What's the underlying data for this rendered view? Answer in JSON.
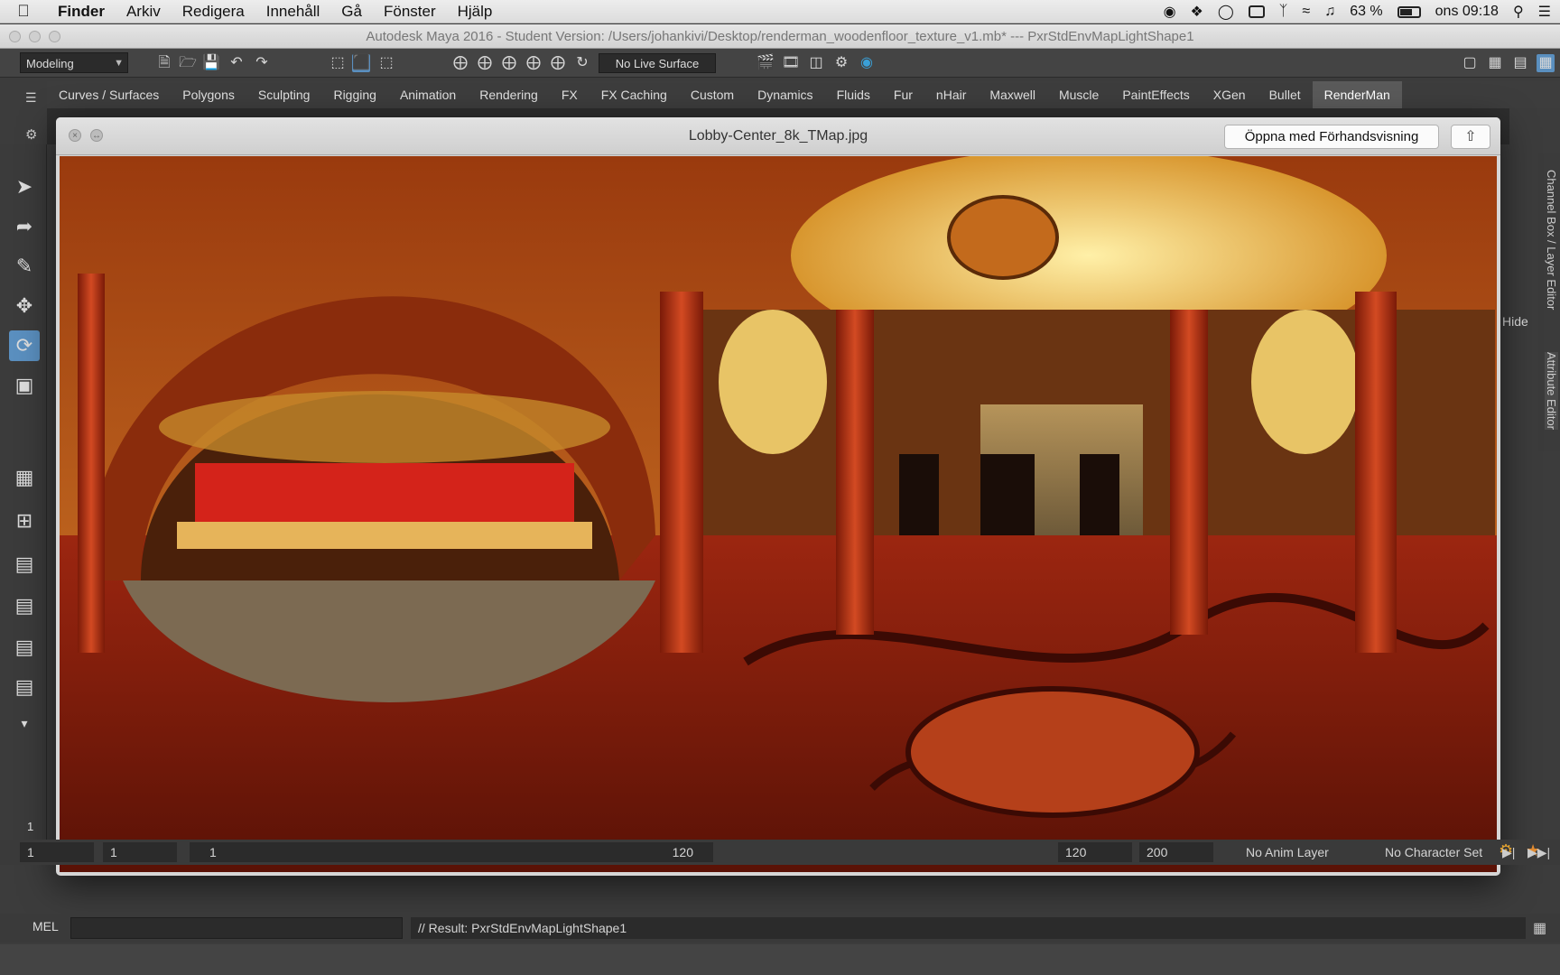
{
  "menubar": {
    "app": "Finder",
    "items": [
      "Arkiv",
      "Redigera",
      "Innehåll",
      "Gå",
      "Fönster",
      "Hjälp"
    ],
    "battery": "63 %",
    "clock": "ons 09:18"
  },
  "maya": {
    "window_title": "Autodesk Maya 2016 - Student Version: /Users/johankivi/Desktop/renderman_woodenfloor_texture_v1.mb*   ---   PxrStdEnvMapLightShape1",
    "mode": "Modeling",
    "live_surface": "No Live Surface",
    "shelf_tabs": [
      "Curves / Surfaces",
      "Polygons",
      "Sculpting",
      "Rigging",
      "Animation",
      "Rendering",
      "FX",
      "FX Caching",
      "Custom",
      "Dynamics",
      "Fluids",
      "Fur",
      "nHair",
      "Maxwell",
      "Muscle",
      "PaintEffects",
      "XGen",
      "Bullet",
      "RenderMan"
    ],
    "active_shelf": "RenderMan",
    "right_tabs": {
      "channel_box": "Channel Box / Layer Editor",
      "attribute_editor": "Attribute Editor"
    },
    "right_panel_label": "Hide",
    "timeline": {
      "current": "1",
      "start": "1",
      "range_start": "1",
      "range_end": "120",
      "end": "120",
      "max": "200",
      "anim_layer": "No Anim Layer",
      "char_set": "No Character Set",
      "frame_marker": "1"
    },
    "command": {
      "label": "MEL",
      "result": "// Result: PxrStdEnvMapLightShape1"
    }
  },
  "quicklook": {
    "title": "Lobby-Center_8k_TMap.jpg",
    "open_button": "Öppna med Förhandsvisning"
  }
}
